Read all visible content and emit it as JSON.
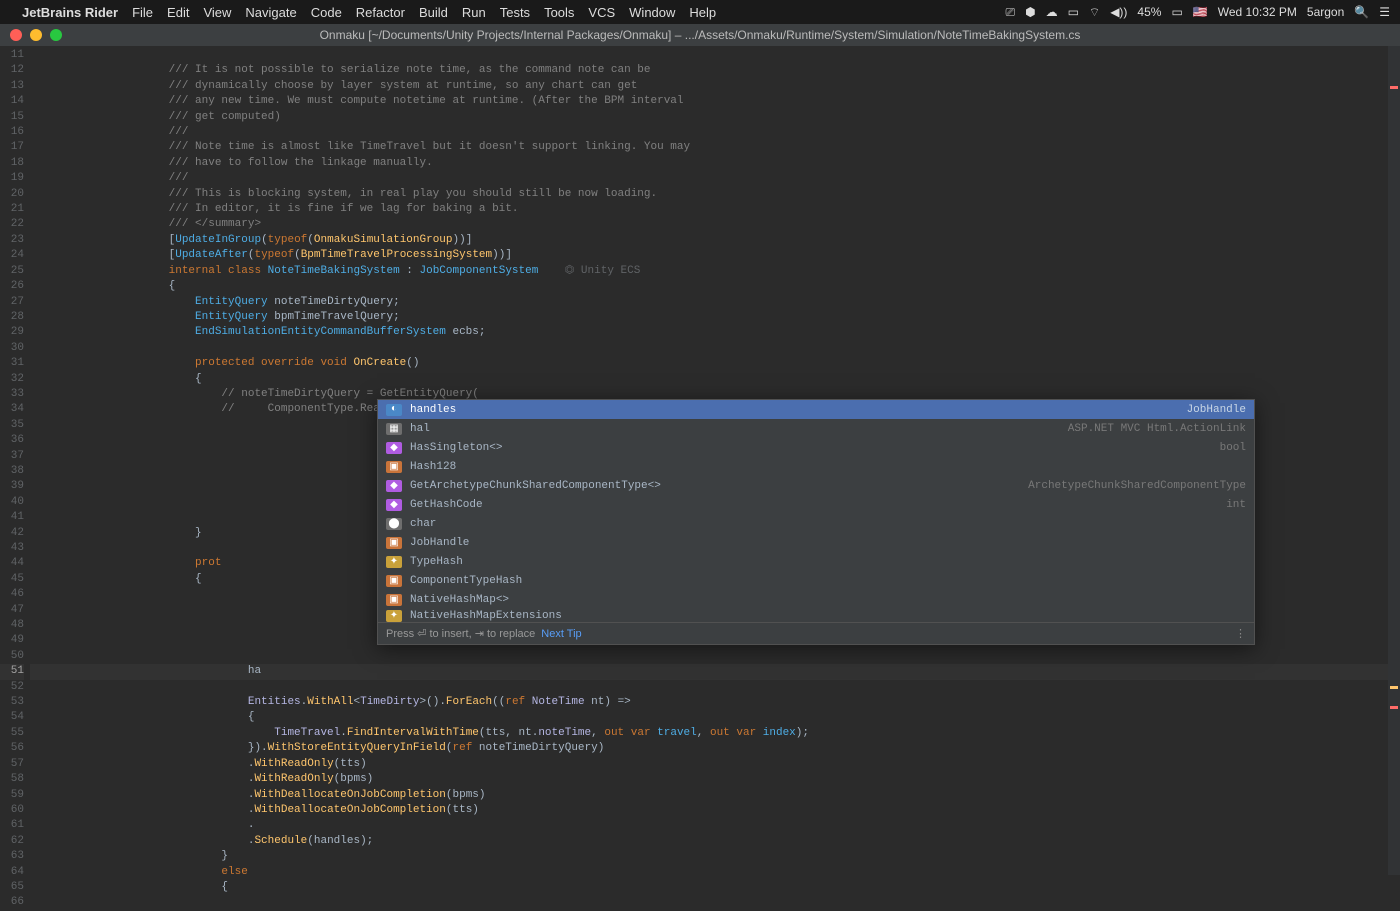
{
  "menubar": {
    "app": "JetBrains Rider",
    "items": [
      "File",
      "Edit",
      "View",
      "Navigate",
      "Code",
      "Refactor",
      "Build",
      "Run",
      "Tests",
      "Tools",
      "VCS",
      "Window",
      "Help"
    ],
    "battery": "45%",
    "clock": "Wed 10:32 PM",
    "user": "5argon"
  },
  "titlebar": {
    "text": "Onmaku [~/Documents/Unity Projects/Internal Packages/Onmaku] – .../Assets/Onmaku/Runtime/System/Simulation/NoteTimeBakingSystem.cs"
  },
  "gutter": {
    "start": 11,
    "end": 66,
    "current": 51
  },
  "code": {
    "l11": "/// It is not possible to serialize note time, as the command note can be",
    "l12": "/// dynamically choose by layer system at runtime, so any chart can get",
    "l13": "/// any new time. We must compute notetime at runtime. (After the BPM interval",
    "l14": "/// get computed)",
    "l15": "///",
    "l16": "/// Note time is almost like TimeTravel but it doesn't support linking. You may",
    "l17": "/// have to follow the linkage manually.",
    "l18": "///",
    "l19": "/// This is blocking system, in real play you should still be now loading.",
    "l20": "/// In editor, it is fine if we lag for baking a bit.",
    "l21": "/// </summary>",
    "l22a": "[",
    "l22b": "UpdateInGroup",
    "l22c": "(",
    "l22d": "typeof",
    "l22e": "(",
    "l22f": "OnmakuSimulationGroup",
    "l22g": "))]",
    "l23a": "[",
    "l23b": "UpdateAfter",
    "l23c": "(",
    "l23d": "typeof",
    "l23e": "(",
    "l23f": "BpmTimeTravelProcessingSystem",
    "l23g": "))]",
    "l24a": "internal class ",
    "l24b": "NoteTimeBakingSystem",
    "l24c": " : ",
    "l24d": "JobComponentSystem",
    "l24e": "    ⏣ Unity ECS",
    "l25": "{",
    "l26a": "    ",
    "l26b": "EntityQuery",
    "l26c": " noteTimeDirtyQuery;",
    "l27a": "    ",
    "l27b": "EntityQuery",
    "l27c": " bpmTimeTravelQuery;",
    "l28a": "    ",
    "l28b": "EndSimulationEntityCommandBufferSystem",
    "l28c": " ecbs;",
    "l30a": "    ",
    "l30b": "protected override void ",
    "l30c": "OnCreate",
    "l30d": "()",
    "l31": "    {",
    "l32": "        // noteTimeDirtyQuery = GetEntityQuery(",
    "l33": "        //     ComponentType.ReadOnly<NoteTime>(),",
    "l42": "    }",
    "l43a": "    ",
    "l43b": "prot",
    "l44": "    {",
    "l50": "            ha",
    "l52a": "            ",
    "l52b": "Entities",
    "l52c": ".",
    "l52d": "WithAll",
    "l52e": "<",
    "l52f": "TimeDirty",
    "l52g": ">().",
    "l52h": "ForEach",
    "l52i": "((",
    "l52j": "ref ",
    "l52k": "NoteTime",
    "l52l": " nt) =>",
    "l53": "            {",
    "l54a": "                ",
    "l54b": "TimeTravel",
    "l54c": ".",
    "l54d": "FindIntervalWithTime",
    "l54e": "(tts, nt.",
    "l54f": "noteTime",
    "l54g": ", ",
    "l54h": "out var ",
    "l54i": "travel",
    "l54j": ", ",
    "l54k": "out var ",
    "l54l": "index",
    "l54m": ");",
    "l55a": "            }).",
    "l55b": "WithStoreEntityQueryInField",
    "l55c": "(",
    "l55d": "ref ",
    "l55e": "noteTimeDirtyQuery)",
    "l56a": "            .",
    "l56b": "WithReadOnly",
    "l56c": "(tts)",
    "l57a": "            .",
    "l57b": "WithReadOnly",
    "l57c": "(bpms)",
    "l58a": "            .",
    "l58b": "WithDeallocateOnJobCompletion",
    "l58c": "(bpms)",
    "l59a": "            .",
    "l59b": "WithDeallocateOnJobCompletion",
    "l59c": "(tts)",
    "l60": "            .",
    "l61a": "            .",
    "l61b": "Schedule",
    "l61c": "(handles);",
    "l62": "        }",
    "l63": "        else",
    "l64": "        {"
  },
  "popup": {
    "items": [
      {
        "icon": "◐",
        "iconbg": "#4a88c7",
        "label": "handles",
        "ret": "JobHandle",
        "sel": true
      },
      {
        "icon": "▦",
        "iconbg": "#6e6e6e",
        "label": "hal",
        "ret": "ASP.NET MVC Html.ActionLink"
      },
      {
        "icon": "◆",
        "iconbg": "#b05ce2",
        "label": "HasSingleton<>",
        "ret": "bool"
      },
      {
        "icon": "▣",
        "iconbg": "#c9743a",
        "label": "Hash128",
        "ret": ""
      },
      {
        "icon": "◆",
        "iconbg": "#b05ce2",
        "label": "GetArchetypeChunkSharedComponentType<>",
        "ret": "ArchetypeChunkSharedComponentType<T>"
      },
      {
        "icon": "◆",
        "iconbg": "#b05ce2",
        "label": "GetHashCode",
        "ret": "int"
      },
      {
        "icon": "⬤",
        "iconbg": "#6e6e6e",
        "label": "char",
        "ret": ""
      },
      {
        "icon": "▣",
        "iconbg": "#c9743a",
        "label": "JobHandle",
        "ret": ""
      },
      {
        "icon": "✦",
        "iconbg": "#c9a13a",
        "label": "TypeHash",
        "ret": ""
      },
      {
        "icon": "▣",
        "iconbg": "#c9743a",
        "label": "ComponentTypeHash",
        "ret": ""
      },
      {
        "icon": "▣",
        "iconbg": "#c9743a",
        "label": "NativeHashMap<>",
        "ret": ""
      },
      {
        "icon": "✦",
        "iconbg": "#c9a13a",
        "label": "NativeHashMapExtensions",
        "ret": ""
      }
    ],
    "footer": "Press ⏎ to insert, ⇥ to replace",
    "tip": "Next Tip"
  }
}
